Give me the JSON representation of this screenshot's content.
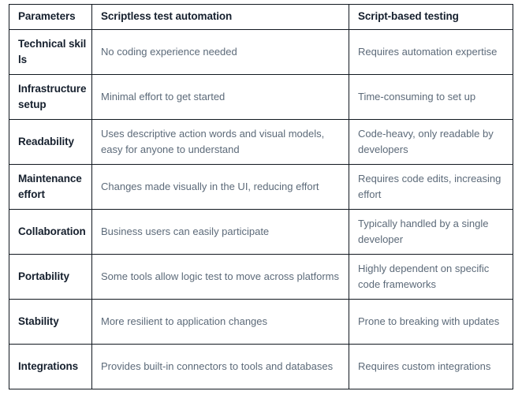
{
  "table": {
    "headers": [
      "Parameters",
      "Scriptless test automation",
      "Script-based testing"
    ],
    "rows": [
      {
        "parameter": "Technical skills",
        "scriptless": "No coding experience needed",
        "script_based": "Requires automation expertise"
      },
      {
        "parameter": "Infrastructure setup",
        "scriptless": "Minimal effort to get started",
        "script_based": "Time-consuming to set up"
      },
      {
        "parameter": "Readability",
        "scriptless": "Uses descriptive action words and visual models, easy for anyone to understand",
        "script_based": "Code-heavy, only readable by developers"
      },
      {
        "parameter": "Maintenance effort",
        "scriptless": "Changes made visually in the UI, reducing effort",
        "script_based": "Requires code edits, increasing effort"
      },
      {
        "parameter": "Collaboration",
        "scriptless": "Business users can easily participate",
        "script_based": "Typically handled by a single developer"
      },
      {
        "parameter": "Portability",
        "scriptless": "Some tools allow logic test to move across platforms",
        "script_based": "Highly dependent on specific code frameworks"
      },
      {
        "parameter": "Stability",
        "scriptless": "More resilient to application changes",
        "script_based": "Prone to breaking with updates"
      },
      {
        "parameter": "Integrations",
        "scriptless": "Provides built-in connectors to tools and databases",
        "script_based": "Requires custom integrations"
      }
    ]
  },
  "colors": {
    "border": "#111820",
    "header_text": "#16202e",
    "body_text": "#5c6a79",
    "background": "#ffffff"
  }
}
